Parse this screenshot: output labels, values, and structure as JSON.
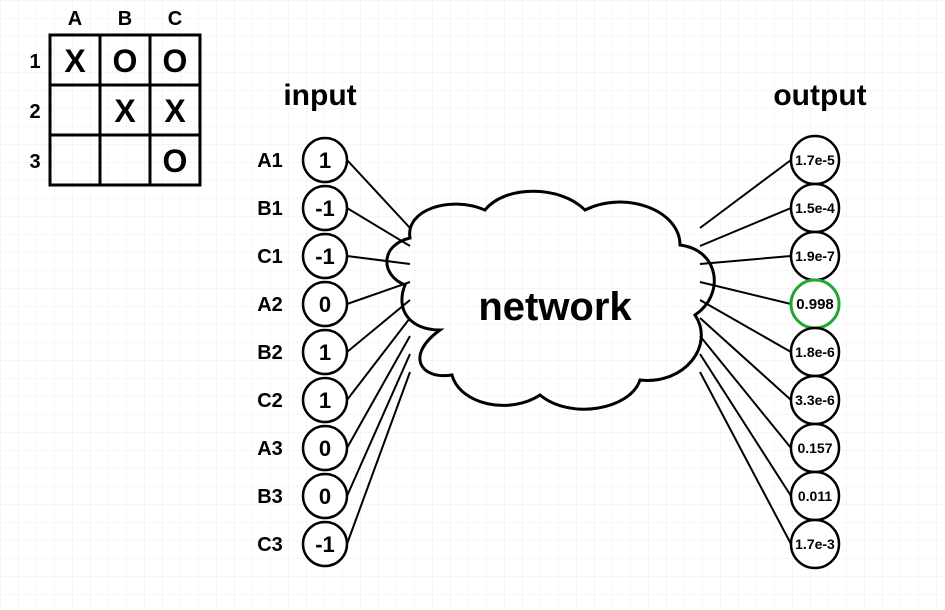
{
  "board": {
    "cols": [
      "A",
      "B",
      "C"
    ],
    "rows": [
      "1",
      "2",
      "3"
    ],
    "cells": {
      "A1": "X",
      "B1": "O",
      "C1": "O",
      "A2": "",
      "B2": "X",
      "C2": "X",
      "A3": "",
      "B3": "",
      "C3": "O"
    }
  },
  "labels": {
    "input": "input",
    "output": "output",
    "network": "network"
  },
  "inputNodes": [
    {
      "name": "A1",
      "value": "1"
    },
    {
      "name": "B1",
      "value": "-1"
    },
    {
      "name": "C1",
      "value": "-1"
    },
    {
      "name": "A2",
      "value": "0"
    },
    {
      "name": "B2",
      "value": "1"
    },
    {
      "name": "C2",
      "value": "1"
    },
    {
      "name": "A3",
      "value": "0"
    },
    {
      "name": "B3",
      "value": "0"
    },
    {
      "name": "C3",
      "value": "-1"
    }
  ],
  "outputNodes": [
    {
      "value": "1.7e-5",
      "highlight": false
    },
    {
      "value": "1.5e-4",
      "highlight": false
    },
    {
      "value": "1.9e-7",
      "highlight": false
    },
    {
      "value": "0.998",
      "highlight": true
    },
    {
      "value": "1.8e-6",
      "highlight": false
    },
    {
      "value": "3.3e-6",
      "highlight": false
    },
    {
      "value": "0.157",
      "highlight": false
    },
    {
      "value": "0.011",
      "highlight": false
    },
    {
      "value": "1.7e-3",
      "highlight": false
    }
  ],
  "colors": {
    "highlight": "#1fa82e",
    "grid": "#eeeeee"
  },
  "chart_data": {
    "type": "table",
    "description": "Tic-tac-toe board encoded as 9 inputs (X=1,O=-1,blank=0) fed into a neural network producing 9 output probabilities; A2 (value 0.998) is highlighted.",
    "board": [
      [
        "X",
        "O",
        "O"
      ],
      [
        "",
        "X",
        "X"
      ],
      [
        "",
        "",
        "O"
      ]
    ],
    "inputs": {
      "A1": 1,
      "B1": -1,
      "C1": -1,
      "A2": 0,
      "B2": 1,
      "C2": 1,
      "A3": 0,
      "B3": 0,
      "C3": -1
    },
    "outputs": [
      1.7e-05,
      0.00015,
      1.9e-07,
      0.998,
      1.8e-06,
      3.3e-06,
      0.157,
      0.011,
      0.0017
    ],
    "highlight_index": 3
  }
}
